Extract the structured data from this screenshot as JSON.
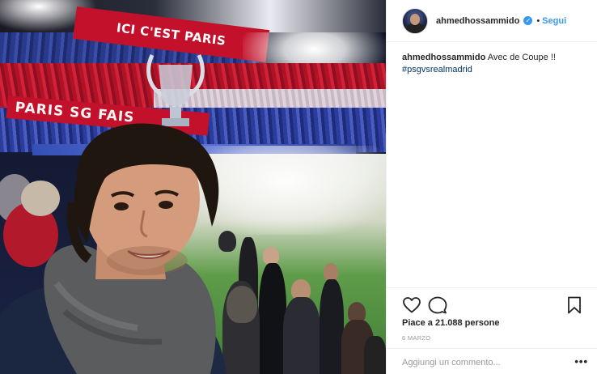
{
  "photo": {
    "roof_banner_text": "ICI C'EST PARIS",
    "tifo_banner_text": "PARIS SG FAIS"
  },
  "post": {
    "username": "ahmedhossammido",
    "follow_label": "Segui",
    "separator": "•",
    "caption_username": "ahmedhossammido",
    "caption_text": "Avec de Coupe !!",
    "hashtag": "#psgvsrealmadrid",
    "likes_text": "Piace a 21.088 persone",
    "date_text": "6 MARZO",
    "comment_placeholder": "Aggiungi un commento...",
    "more_label": "•••"
  },
  "icons": {
    "like": "heart-icon",
    "comment": "comment-icon",
    "save": "bookmark-icon",
    "verified": "verified-badge-icon"
  },
  "colors": {
    "link_blue": "#3897f0",
    "hashtag_blue": "#003569",
    "psg_red": "#c3112b",
    "text": "#262626",
    "muted": "#999999"
  }
}
